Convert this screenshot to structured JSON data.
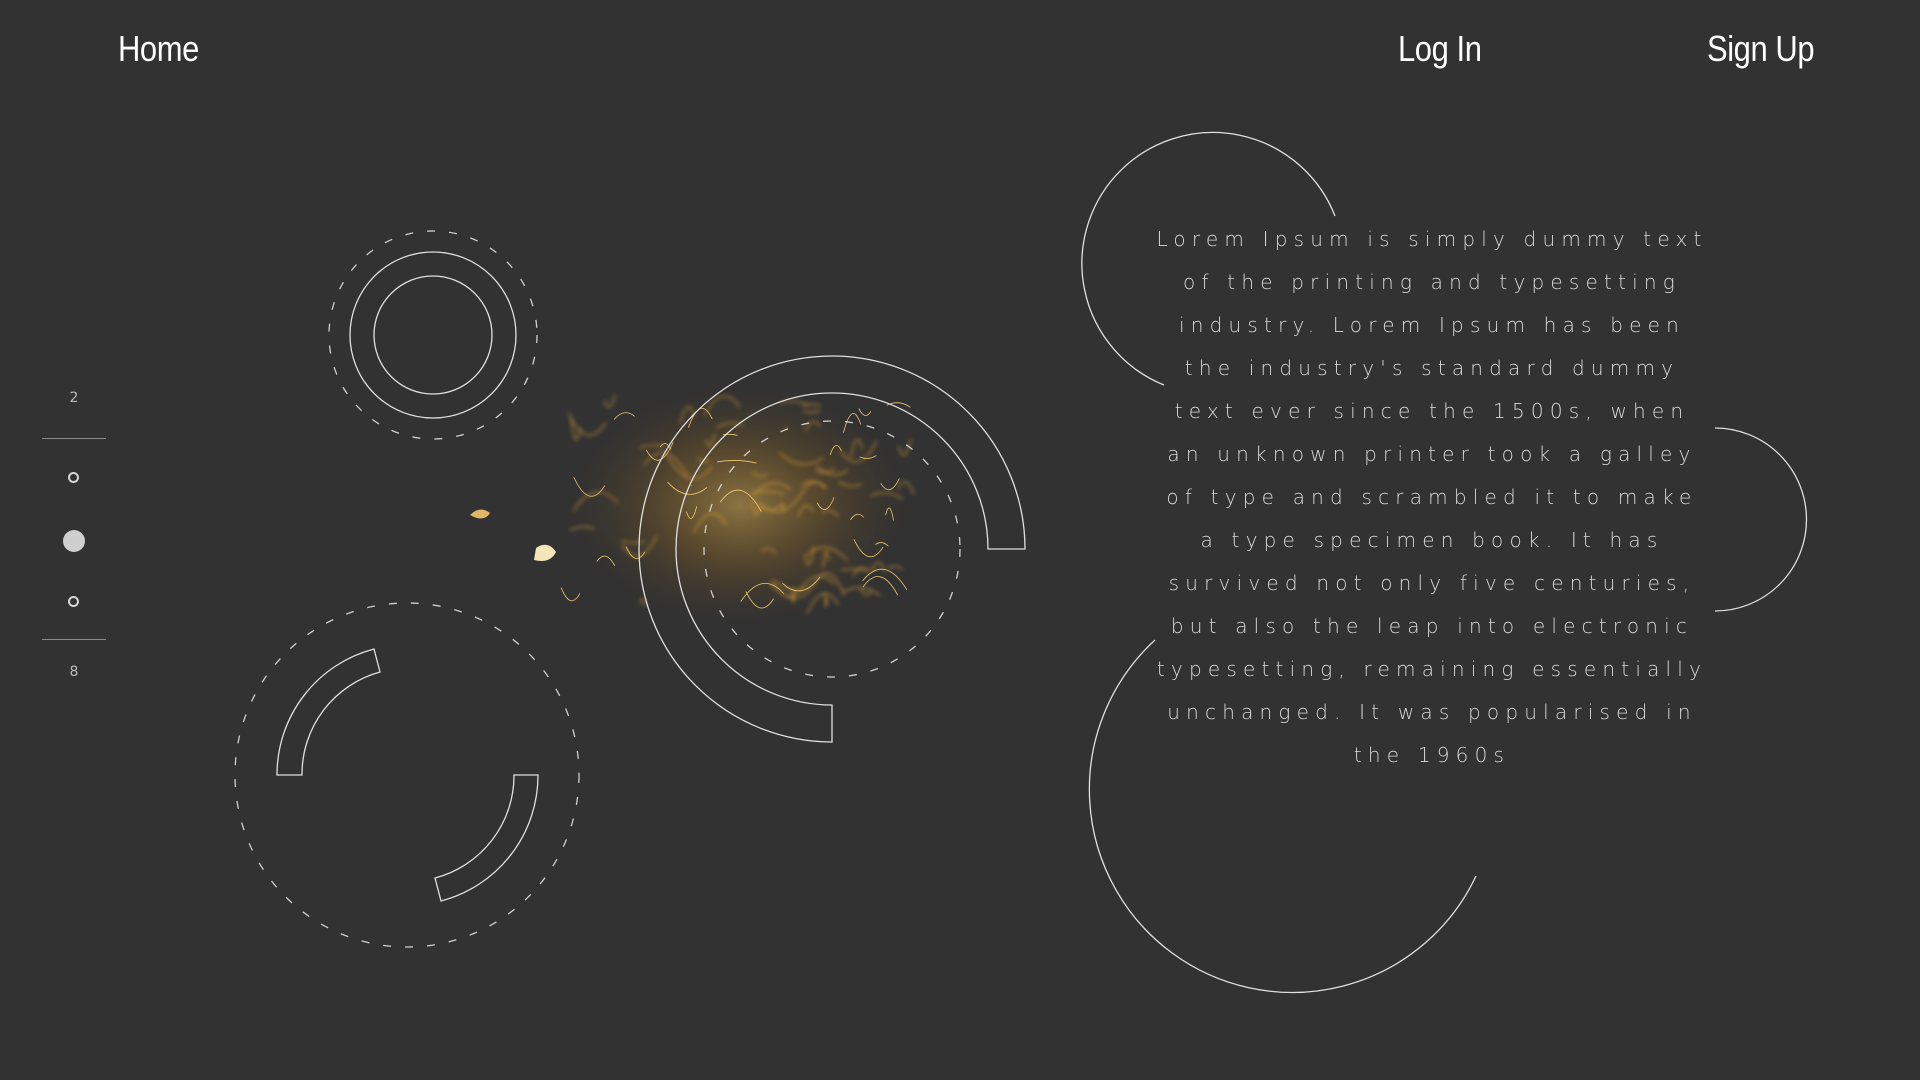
{
  "nav": {
    "home": "Home",
    "login": "Log In",
    "signup": "Sign Up"
  },
  "pager": {
    "first": "2",
    "last": "8",
    "active_index": 1,
    "dot_count": 3
  },
  "content": {
    "paragraph": "Lorem Ipsum is simply dummy text of the printing and typesetting industry. Lorem Ipsum has been the industry's standard dummy text ever since the 1500s, when an unknown printer took a galley of type and scrambled it to make a type specimen book. It has survived not only five centuries, but also the leap into electronic typesetting, remaining essentially unchanged. It was popularised in the 1960s"
  },
  "colors": {
    "background": "#323232",
    "line": "#e0e0e0",
    "accent_glow": "#e0a030"
  }
}
